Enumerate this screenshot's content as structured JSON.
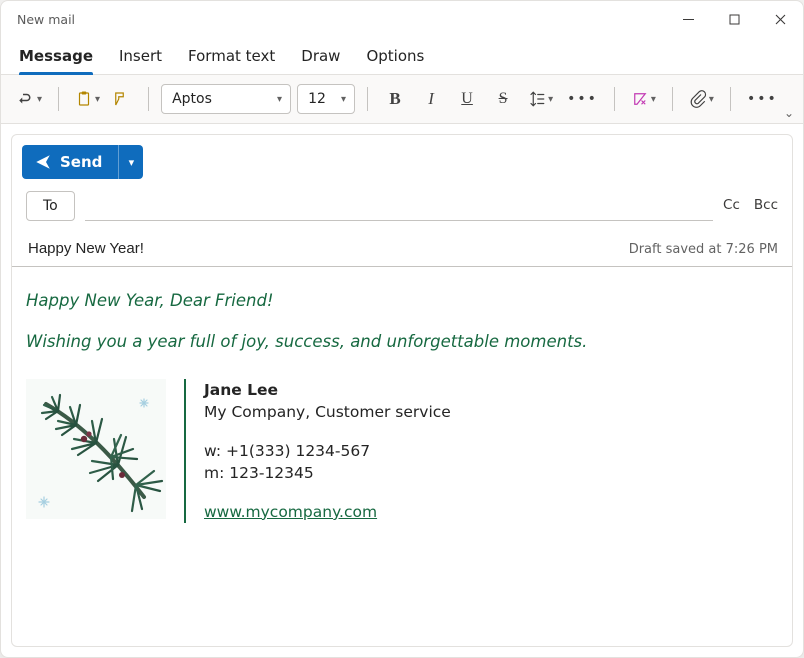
{
  "window": {
    "title": "New mail"
  },
  "tabs": {
    "items": [
      {
        "label": "Message",
        "active": true
      },
      {
        "label": "Insert",
        "active": false
      },
      {
        "label": "Format text",
        "active": false
      },
      {
        "label": "Draw",
        "active": false
      },
      {
        "label": "Options",
        "active": false
      }
    ]
  },
  "ribbon": {
    "font_name": "Aptos",
    "font_size": "12"
  },
  "compose": {
    "send_label": "Send",
    "to_label": "To",
    "cc_label": "Cc",
    "bcc_label": "Bcc",
    "subject": "Happy New Year!",
    "draft_status": "Draft saved at 7:26 PM"
  },
  "body": {
    "para1": "Happy New Year, Dear Friend!",
    "para2": "Wishing you a year full of joy, success, and unforgettable moments."
  },
  "signature": {
    "name": "Jane Lee",
    "company_line": "My Company, Customer service",
    "phone_work_label": "w:",
    "phone_work": "+1(333) 1234-567",
    "phone_mobile_label": "m:",
    "phone_mobile": "123-12345",
    "website": "www.mycompany.com",
    "image_alt": "pine-branch-illustration"
  }
}
